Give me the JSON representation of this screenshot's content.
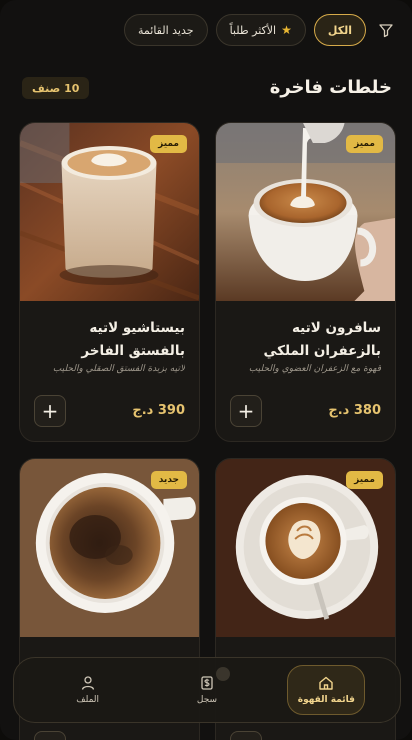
{
  "filters": {
    "all": "الكل",
    "most_ordered": "الأكثر طلباً",
    "new_menu": "جديد القائمة"
  },
  "section": {
    "title": "خلطات فاخرة",
    "count": "10 صنف"
  },
  "products": [
    {
      "name": "سافرون لاتيه بالزعفران الملكي",
      "description": "قهوة مع الزعفران العضوي والحليب",
      "price": "380 د.ج",
      "tag": "مميز",
      "add": "+"
    },
    {
      "name": "بيستاشيو لاتيه بالفستق الفاخر",
      "description": "لاتيه بزبدة الفستق الصقلي والحليب",
      "price": "390 د.ج",
      "tag": "مميز",
      "add": "+"
    },
    {
      "name": "",
      "description": "",
      "price": "",
      "tag": "مميز",
      "add": "+"
    },
    {
      "name": "",
      "description": "",
      "price": "",
      "tag": "جديد",
      "add": "+"
    }
  ],
  "nav": {
    "menu": "قائمة القهوة",
    "history": "سجل",
    "profile": "الملف"
  },
  "colors": {
    "accent": "#e6c36f",
    "tag_bg": "#e2b945",
    "background": "#121110"
  },
  "icons": {
    "filter": "filter-icon",
    "star": "star-icon",
    "add": "plus-icon",
    "home": "home-icon",
    "receipt": "receipt-icon",
    "user": "user-icon"
  }
}
